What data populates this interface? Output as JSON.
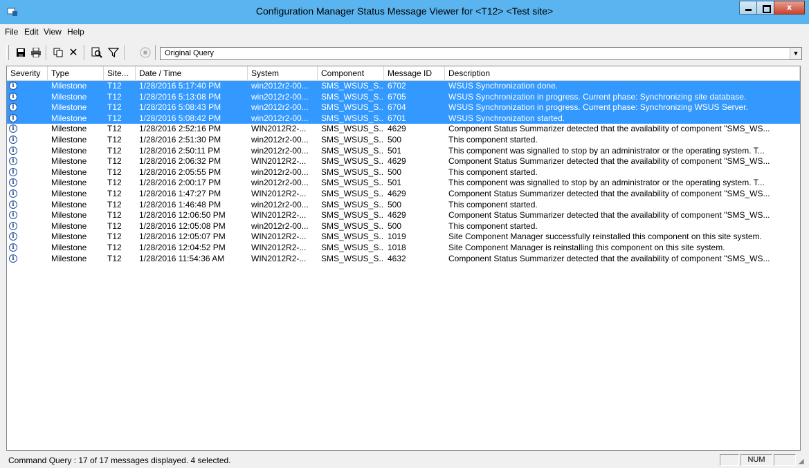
{
  "window": {
    "title": "Configuration Manager Status Message Viewer for <T12> <Test site>",
    "minimize": "_",
    "close": "x"
  },
  "menu": [
    "File",
    "Edit",
    "View",
    "Help"
  ],
  "toolbar": {
    "query": "Original Query"
  },
  "columns": [
    "Severity",
    "Type",
    "Site...",
    "Date / Time",
    "System",
    "Component",
    "Message ID",
    "Description"
  ],
  "rows": [
    {
      "type": "Milestone",
      "site": "T12",
      "datetime": "1/28/2016 5:17:40 PM",
      "system": "win2012r2-00...",
      "component": "SMS_WSUS_S...",
      "id": "6702",
      "desc": "WSUS Synchronization done.",
      "selected": true
    },
    {
      "type": "Milestone",
      "site": "T12",
      "datetime": "1/28/2016 5:13:08 PM",
      "system": "win2012r2-00...",
      "component": "SMS_WSUS_S...",
      "id": "6705",
      "desc": "WSUS Synchronization in progress. Current phase: Synchronizing site database.",
      "selected": true
    },
    {
      "type": "Milestone",
      "site": "T12",
      "datetime": "1/28/2016 5:08:43 PM",
      "system": "win2012r2-00...",
      "component": "SMS_WSUS_S...",
      "id": "6704",
      "desc": "WSUS Synchronization in progress. Current phase: Synchronizing WSUS Server.",
      "selected": true
    },
    {
      "type": "Milestone",
      "site": "T12",
      "datetime": "1/28/2016 5:08:42 PM",
      "system": "win2012r2-00...",
      "component": "SMS_WSUS_S...",
      "id": "6701",
      "desc": "WSUS Synchronization started.",
      "selected": true
    },
    {
      "type": "Milestone",
      "site": "T12",
      "datetime": "1/28/2016 2:52:16 PM",
      "system": "WIN2012R2-...",
      "component": "SMS_WSUS_S...",
      "id": "4629",
      "desc": "Component Status Summarizer detected that the availability of component \"SMS_WS...",
      "selected": false
    },
    {
      "type": "Milestone",
      "site": "T12",
      "datetime": "1/28/2016 2:51:30 PM",
      "system": "win2012r2-00...",
      "component": "SMS_WSUS_S...",
      "id": "500",
      "desc": "This component started.",
      "selected": false
    },
    {
      "type": "Milestone",
      "site": "T12",
      "datetime": "1/28/2016 2:50:11 PM",
      "system": "win2012r2-00...",
      "component": "SMS_WSUS_S...",
      "id": "501",
      "desc": "This component was signalled to stop by an administrator or the operating system. T...",
      "selected": false
    },
    {
      "type": "Milestone",
      "site": "T12",
      "datetime": "1/28/2016 2:06:32 PM",
      "system": "WIN2012R2-...",
      "component": "SMS_WSUS_S...",
      "id": "4629",
      "desc": "Component Status Summarizer detected that the availability of component \"SMS_WS...",
      "selected": false
    },
    {
      "type": "Milestone",
      "site": "T12",
      "datetime": "1/28/2016 2:05:55 PM",
      "system": "win2012r2-00...",
      "component": "SMS_WSUS_S...",
      "id": "500",
      "desc": "This component started.",
      "selected": false
    },
    {
      "type": "Milestone",
      "site": "T12",
      "datetime": "1/28/2016 2:00:17 PM",
      "system": "win2012r2-00...",
      "component": "SMS_WSUS_S...",
      "id": "501",
      "desc": "This component was signalled to stop by an administrator or the operating system. T...",
      "selected": false
    },
    {
      "type": "Milestone",
      "site": "T12",
      "datetime": "1/28/2016 1:47:27 PM",
      "system": "WIN2012R2-...",
      "component": "SMS_WSUS_S...",
      "id": "4629",
      "desc": "Component Status Summarizer detected that the availability of component \"SMS_WS...",
      "selected": false
    },
    {
      "type": "Milestone",
      "site": "T12",
      "datetime": "1/28/2016 1:46:48 PM",
      "system": "win2012r2-00...",
      "component": "SMS_WSUS_S...",
      "id": "500",
      "desc": "This component started.",
      "selected": false
    },
    {
      "type": "Milestone",
      "site": "T12",
      "datetime": "1/28/2016 12:06:50 PM",
      "system": "WIN2012R2-...",
      "component": "SMS_WSUS_S...",
      "id": "4629",
      "desc": "Component Status Summarizer detected that the availability of component \"SMS_WS...",
      "selected": false
    },
    {
      "type": "Milestone",
      "site": "T12",
      "datetime": "1/28/2016 12:05:08 PM",
      "system": "win2012r2-00...",
      "component": "SMS_WSUS_S...",
      "id": "500",
      "desc": "This component started.",
      "selected": false
    },
    {
      "type": "Milestone",
      "site": "T12",
      "datetime": "1/28/2016 12:05:07 PM",
      "system": "WIN2012R2-...",
      "component": "SMS_WSUS_S...",
      "id": "1019",
      "desc": "Site Component Manager successfully reinstalled this component on this site system.",
      "selected": false
    },
    {
      "type": "Milestone",
      "site": "T12",
      "datetime": "1/28/2016 12:04:52 PM",
      "system": "WIN2012R2-...",
      "component": "SMS_WSUS_S...",
      "id": "1018",
      "desc": "Site Component Manager is reinstalling this component on this site system.",
      "selected": false
    },
    {
      "type": "Milestone",
      "site": "T12",
      "datetime": "1/28/2016 11:54:36 AM",
      "system": "WIN2012R2-...",
      "component": "SMS_WSUS_S...",
      "id": "4632",
      "desc": "Component Status Summarizer detected that the availability of component \"SMS_WS...",
      "selected": false
    }
  ],
  "status": {
    "message": "Command Query : 17 of 17 messages displayed. 4 selected.",
    "num": "NUM"
  },
  "colors": {
    "titlebar": "#5ab4ef",
    "selection": "#3399ff"
  }
}
